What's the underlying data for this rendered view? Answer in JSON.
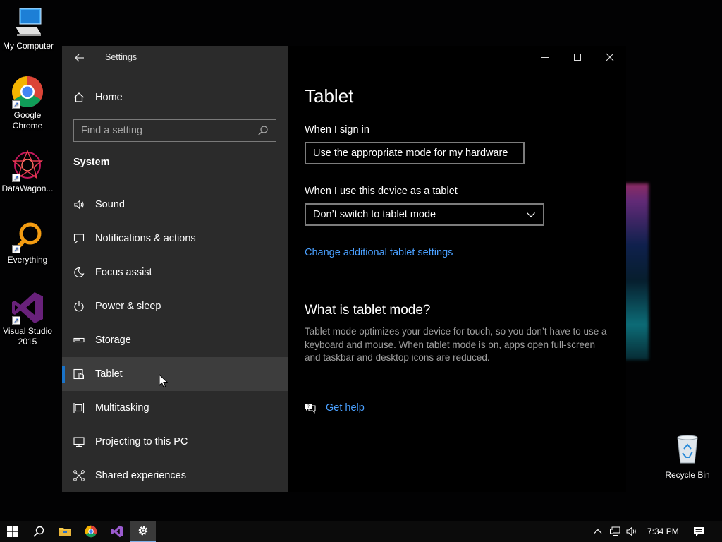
{
  "desktop": {
    "icons": [
      {
        "label": "My Computer"
      },
      {
        "label": "Google Chrome"
      },
      {
        "label": "DataWagon..."
      },
      {
        "label": "Everything"
      },
      {
        "label": "Visual Studio 2015"
      }
    ],
    "recycle_bin": {
      "label": "Recycle Bin"
    }
  },
  "window": {
    "title": "Settings",
    "sidebar": {
      "home_label": "Home",
      "search_placeholder": "Find a setting",
      "section_title": "System",
      "items": [
        {
          "label": "Sound",
          "icon": "speaker-icon"
        },
        {
          "label": "Notifications & actions",
          "icon": "notification-icon"
        },
        {
          "label": "Focus assist",
          "icon": "moon-icon"
        },
        {
          "label": "Power & sleep",
          "icon": "power-icon"
        },
        {
          "label": "Storage",
          "icon": "storage-icon"
        },
        {
          "label": "Tablet",
          "icon": "tablet-icon",
          "active": true
        },
        {
          "label": "Multitasking",
          "icon": "multitasking-icon"
        },
        {
          "label": "Projecting to this PC",
          "icon": "projecting-icon"
        },
        {
          "label": "Shared experiences",
          "icon": "shared-icon"
        }
      ]
    },
    "content": {
      "title": "Tablet",
      "sign_in_label": "When I sign in",
      "sign_in_value": "Use the appropriate mode for my hardware",
      "tablet_label": "When I use this device as a tablet",
      "tablet_value": "Don’t switch to tablet mode",
      "additional_link": "Change additional tablet settings",
      "what_is_title": "What is tablet mode?",
      "what_is_text": "Tablet mode optimizes your device for touch, so you don’t have to use a keyboard and mouse. When tablet mode is on, apps open full-screen and taskbar and desktop icons are reduced.",
      "help_link": "Get help"
    }
  },
  "taskbar": {
    "clock": "7:34 PM",
    "accent": "#7fb0e8"
  },
  "colors": {
    "sidebar_bg": "#2b2b2b",
    "active_item_bg": "#3d3d3d",
    "accent": "#1a73c8",
    "link": "#4aa0ff"
  }
}
